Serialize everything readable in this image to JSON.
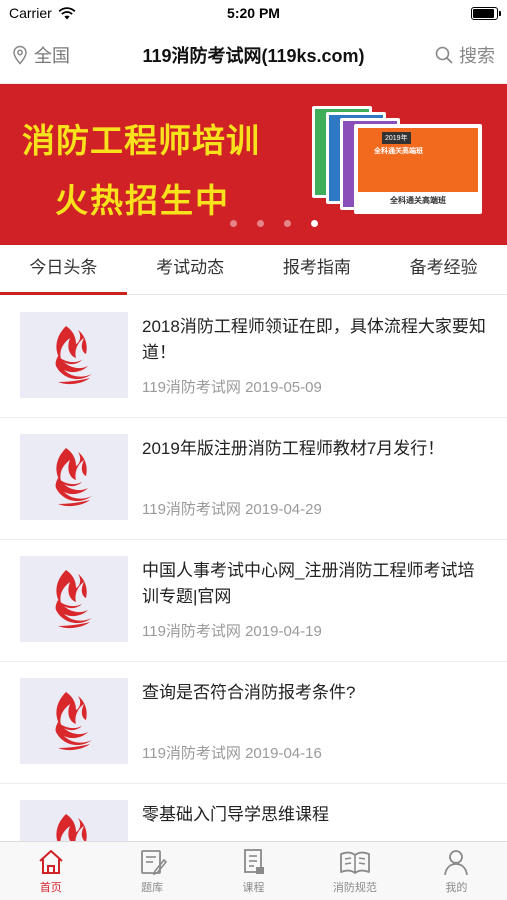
{
  "status_bar": {
    "carrier": "Carrier",
    "time": "5:20 PM",
    "battery_level": 0.95
  },
  "nav": {
    "location": "全国",
    "title": "119消防考试网(119ks.com)",
    "search_label": "搜索"
  },
  "banner": {
    "title": "消防工程师培训",
    "subtitle": "火热招生中",
    "book_tag": "2019年",
    "book_line": "全科通关高端班",
    "book_band": "全科通关高端班",
    "dot_count": 4,
    "active_dot": 3
  },
  "tabs": [
    {
      "label": "今日头条",
      "active": true
    },
    {
      "label": "考试动态",
      "active": false
    },
    {
      "label": "报考指南",
      "active": false
    },
    {
      "label": "备考经验",
      "active": false
    }
  ],
  "articles": [
    {
      "title": "2018消防工程师领证在即，具体流程大家要知道！",
      "meta": "119消防考试网 2019-05-09"
    },
    {
      "title": "2019年版注册消防工程师教材7月发行！",
      "meta": "119消防考试网 2019-04-29"
    },
    {
      "title": "中国人事考试中心网_注册消防工程师考试培训专题|官网",
      "meta": "119消防考试网 2019-04-19"
    },
    {
      "title": "查询是否符合消防报考条件?",
      "meta": "119消防考试网 2019-04-16"
    },
    {
      "title": "零基础入门导学思维课程",
      "meta": ""
    }
  ],
  "tabbar": [
    {
      "label": "首页",
      "icon": "home-icon",
      "active": true
    },
    {
      "label": "题库",
      "icon": "edit-icon",
      "active": false
    },
    {
      "label": "课程",
      "icon": "document-icon",
      "active": false
    },
    {
      "label": "消防规范",
      "icon": "book-icon",
      "active": false
    },
    {
      "label": "我的",
      "icon": "person-icon",
      "active": false
    }
  ],
  "colors": {
    "brand_red": "#d02226",
    "banner_text": "#f7e21c",
    "active_tab": "#c9221e",
    "muted_text": "#9a9a9a"
  }
}
